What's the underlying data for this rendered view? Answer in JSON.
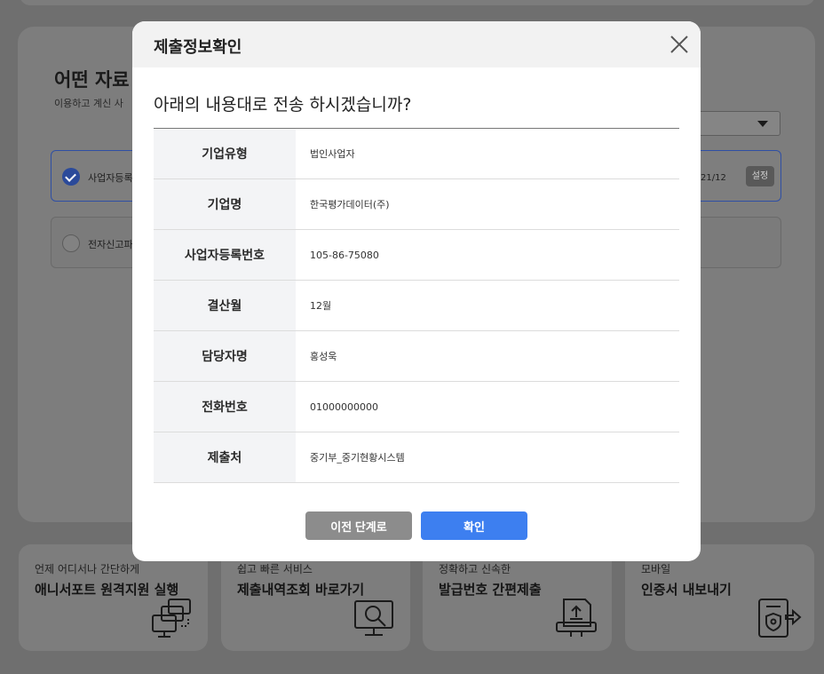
{
  "background": {
    "heading": "어떤 자료",
    "subtext": "이용하고 계신 사",
    "rows": [
      {
        "label": "사업자등록",
        "selected": true,
        "date": "21/12",
        "button": "설정"
      },
      {
        "label": "전자신고파",
        "selected": false
      }
    ],
    "cards": [
      {
        "sub": "언제 어디서나 간단하게",
        "title": "애니서포트 원격지원 실행",
        "icon": "remote-support-icon"
      },
      {
        "sub": "쉽고 빠른 서비스",
        "title": "제출내역조회 바로가기",
        "icon": "search-monitor-icon"
      },
      {
        "sub": "정확하고 신속한",
        "title": "발급번호 간편제출",
        "icon": "upload-document-icon"
      },
      {
        "sub": "모바일",
        "title": "인증서 내보내기",
        "icon": "certificate-export-icon"
      }
    ]
  },
  "modal": {
    "title": "제출정보확인",
    "question": "아래의 내용대로 전송 하시겠습니까?",
    "rows": [
      {
        "key": "기업유형",
        "value": "법인사업자"
      },
      {
        "key": "기업명",
        "value": "한국평가데이터(주)"
      },
      {
        "key": "사업자등록번호",
        "value": "105-86-75080"
      },
      {
        "key": "결산월",
        "value": "12월"
      },
      {
        "key": "담당자명",
        "value": "홍성욱"
      },
      {
        "key": "전화번호",
        "value": "01000000000"
      },
      {
        "key": "제출처",
        "value": "중기부_중기현황시스템"
      }
    ],
    "prev_label": "이전 단계로",
    "ok_label": "확인"
  },
  "colors": {
    "accent": "#3d7ff0",
    "overlay": "#6f6f6f",
    "secondary_button": "#8c8c8c"
  }
}
